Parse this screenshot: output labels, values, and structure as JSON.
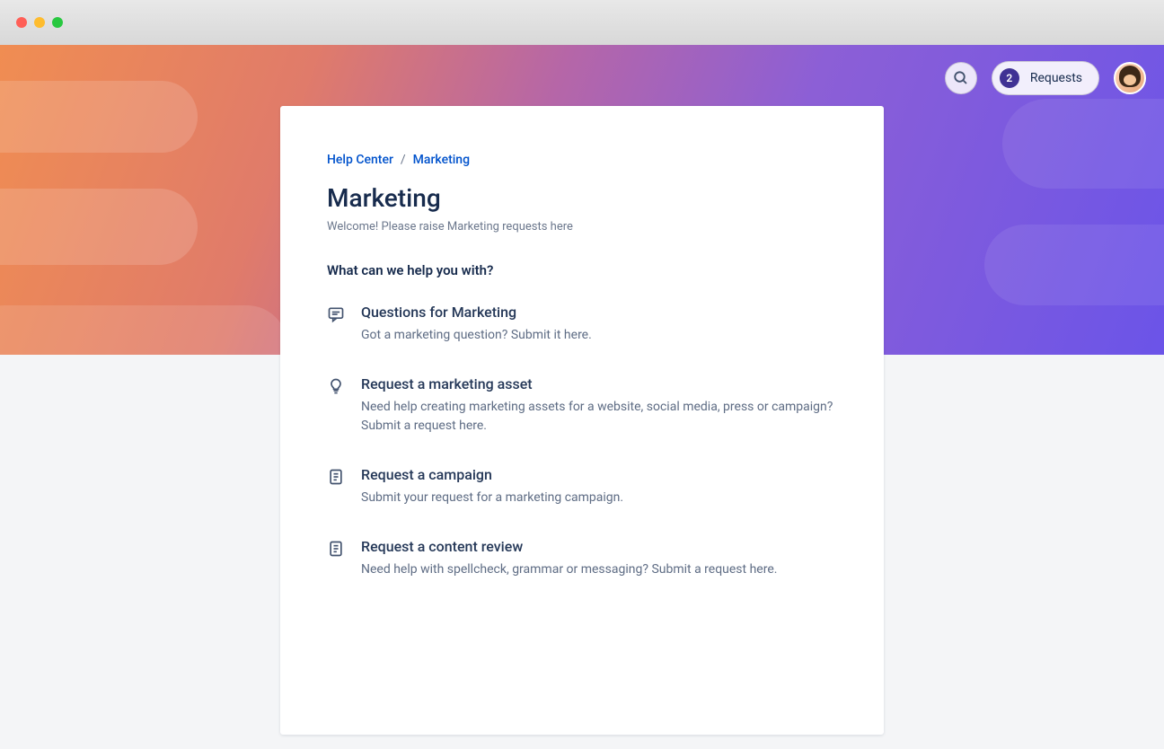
{
  "header": {
    "requests_count": "2",
    "requests_label": "Requests"
  },
  "breadcrumb": {
    "root": "Help Center",
    "separator": "/",
    "current": "Marketing"
  },
  "page": {
    "title": "Marketing",
    "subtitle": "Welcome! Please raise Marketing requests here",
    "section_heading": "What can we help you with?"
  },
  "requests": [
    {
      "title": "Questions for Marketing",
      "description": "Got a marketing question? Submit it here."
    },
    {
      "title": "Request a marketing asset",
      "description": "Need help creating marketing assets for a website, social media, press or campaign?  Submit a request here."
    },
    {
      "title": "Request a campaign",
      "description": "Submit your request for a marketing campaign."
    },
    {
      "title": "Request a content review",
      "description": "Need help with spellcheck, grammar or messaging? Submit a request here."
    }
  ]
}
